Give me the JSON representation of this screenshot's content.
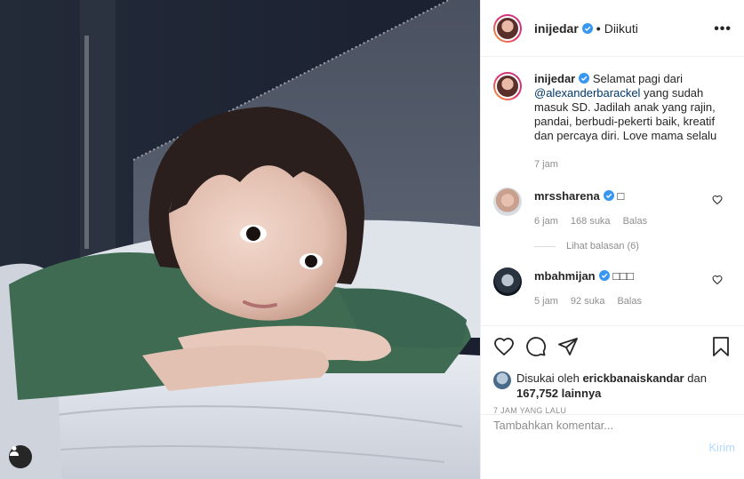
{
  "post": {
    "author": "inijedar",
    "follow_state": "Diikuti",
    "dot": "•",
    "more_label": "•••"
  },
  "caption": {
    "username": "inijedar",
    "text_before": "Selamat pagi dari ",
    "mention": "@alexanderbarackel",
    "text_after": " yang sudah masuk SD. Jadilah anak yang rajin, pandai, berbudi-pekerti baik, kreatif dan percaya diri. Love mama selalu",
    "time": "7 jam"
  },
  "comments": [
    {
      "username": "mrssharena",
      "text": "□",
      "time": "6 jam",
      "likes": "168 suka",
      "reply": "Balas"
    },
    {
      "username": "mbahmijan",
      "text": "□□□",
      "time": "5 jam",
      "likes": "92 suka",
      "reply": "Balas"
    }
  ],
  "view_replies": "Lihat balasan (6)",
  "likes": {
    "prefix": "Disukai oleh ",
    "user": "erickbanaiskandar",
    "middle": " dan",
    "count": "167,752 lainnya"
  },
  "time_ago": "7 JAM YANG LALU",
  "add_comment": {
    "placeholder": "Tambahkan komentar...",
    "post_label": "Kirim"
  },
  "icons": [
    "heart-icon",
    "comment-icon",
    "share-icon",
    "save-icon",
    "user-tag-icon",
    "verified-badge-icon"
  ],
  "colors": {
    "verified": "#3897f0",
    "link": "#00376b",
    "muted": "#8e8e8e",
    "post_disabled": "#b3dbff"
  }
}
